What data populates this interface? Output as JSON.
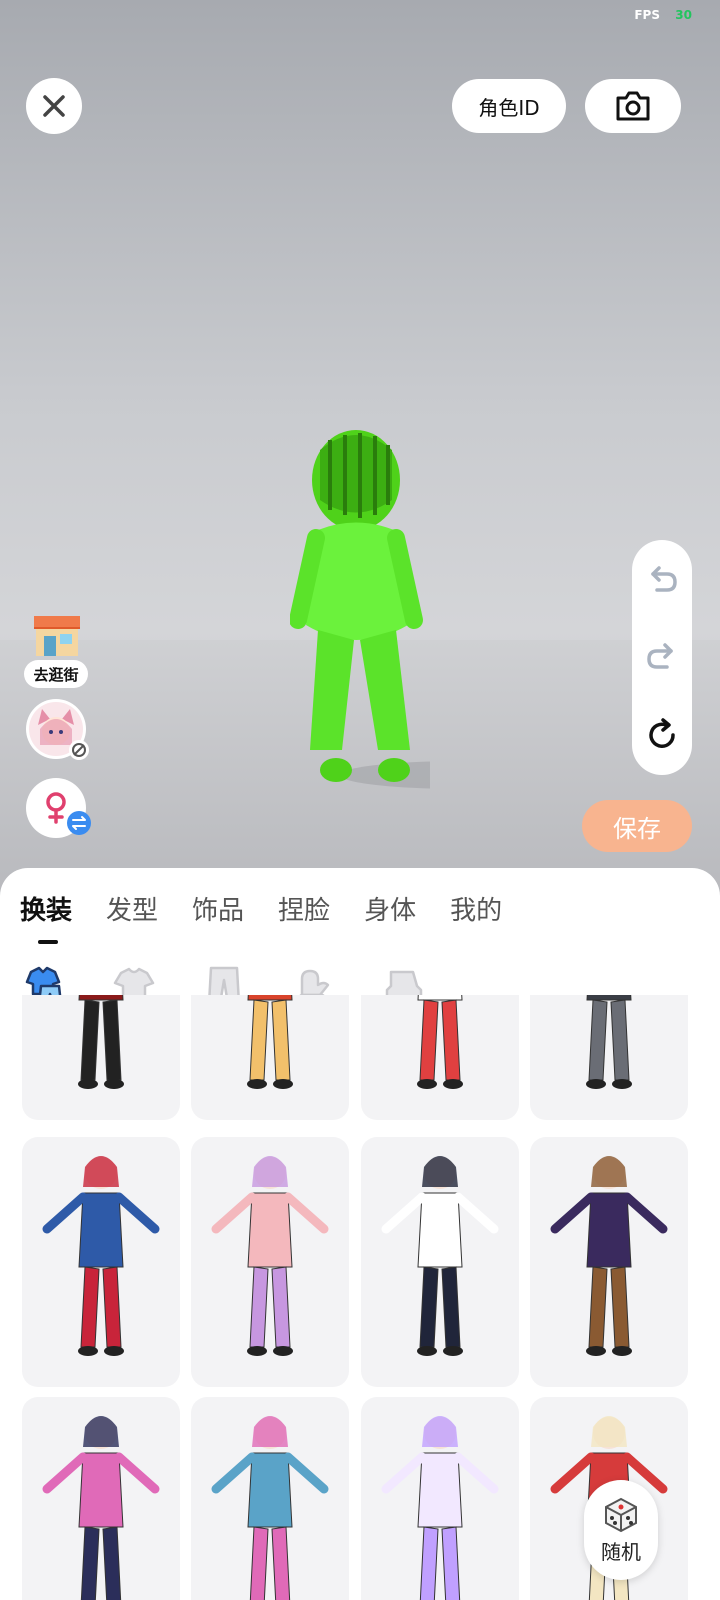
{
  "status": {
    "fps_label": "FPS",
    "fps_value": "30"
  },
  "top_bar": {
    "role_id_label": "角色ID",
    "close_icon": "close-icon",
    "camera_icon": "camera-icon"
  },
  "side_toolbar": {
    "undo_icon": "undo-icon",
    "redo_icon": "redo-icon",
    "reset_icon": "reset-icon"
  },
  "left_actions": {
    "shop_label": "去逛街",
    "gender_icon": "female-icon"
  },
  "save_label": "保存",
  "tabs": [
    {
      "label": "换装",
      "active": true
    },
    {
      "label": "发型"
    },
    {
      "label": "饰品"
    },
    {
      "label": "捏脸"
    },
    {
      "label": "身体"
    },
    {
      "label": "我的"
    }
  ],
  "subcategories": [
    "outfit-set-icon",
    "top-icon",
    "pants-icon",
    "gloves-icon",
    "shoes-icon"
  ],
  "outfits": [
    {
      "name": "outfit-red-black",
      "colors": [
        "#8b1a1a",
        "#222"
      ]
    },
    {
      "name": "outfit-red-shorts",
      "colors": [
        "#d9432b",
        "#f2c06b"
      ]
    },
    {
      "name": "outfit-white-red",
      "colors": [
        "#ffffff",
        "#e04040"
      ]
    },
    {
      "name": "outfit-dark-combat",
      "colors": [
        "#3a3d45",
        "#6a6d75"
      ]
    },
    {
      "name": "outfit-blue-red-hero",
      "colors": [
        "#2e5aa8",
        "#c8243a"
      ]
    },
    {
      "name": "outfit-pink-cat",
      "colors": [
        "#f4b8bd",
        "#c797e0"
      ]
    },
    {
      "name": "outfit-sporty",
      "colors": [
        "#ffffff",
        "#20253a"
      ]
    },
    {
      "name": "outfit-purple-coat",
      "colors": [
        "#3a2a5e",
        "#8a5a32"
      ]
    },
    {
      "name": "outfit-pink-hair",
      "colors": [
        "#e06ab8",
        "#2b2e5a"
      ]
    },
    {
      "name": "outfit-blue-hair",
      "colors": [
        "#5aa3c8",
        "#e06ab8"
      ]
    },
    {
      "name": "outfit-white-fairy",
      "colors": [
        "#f2e8ff",
        "#c0a0ff"
      ]
    },
    {
      "name": "outfit-red-dress",
      "colors": [
        "#d63b3b",
        "#f3e6c2"
      ]
    }
  ],
  "random_label": "随机",
  "colors": {
    "accent_save": "#f8b48f",
    "avatar_green": "#5be32a"
  }
}
